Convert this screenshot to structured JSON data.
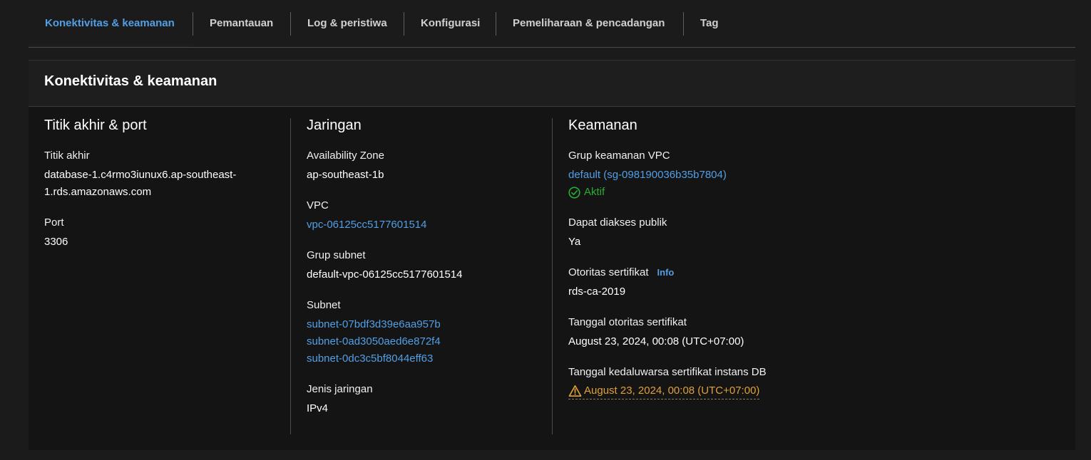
{
  "tabs": [
    {
      "label": "Konektivitas & keamanan",
      "active": true
    },
    {
      "label": "Pemantauan"
    },
    {
      "label": "Log & peristiwa"
    },
    {
      "label": "Konfigurasi"
    },
    {
      "label": "Pemeliharaan & pencadangan"
    },
    {
      "label": "Tag"
    }
  ],
  "panel": {
    "title": "Konektivitas & keamanan"
  },
  "endpoint_col": {
    "title": "Titik akhir & port",
    "endpoint_label": "Titik akhir",
    "endpoint_line1": "database-1.c4rmo3iunux6.ap-southeast-",
    "endpoint_line2": "1.rds.amazonaws.com",
    "port_label": "Port",
    "port_value": "3306"
  },
  "network_col": {
    "title": "Jaringan",
    "az_label": "Availability Zone",
    "az_value": "ap-southeast-1b",
    "vpc_label": "VPC",
    "vpc_value": "vpc-06125cc5177601514",
    "subnet_group_label": "Grup subnet",
    "subnet_group_value": "default-vpc-06125cc5177601514",
    "subnet_label": "Subnet",
    "subnets": [
      "subnet-07bdf3d39e6aa957b",
      "subnet-0ad3050aed6e872f4",
      "subnet-0dc3c5bf8044eff63"
    ],
    "network_type_label": "Jenis jaringan",
    "network_type_value": "IPv4"
  },
  "security_col": {
    "title": "Keamanan",
    "sg_label": "Grup keamanan VPC",
    "sg_value": "default (sg-098190036b35b7804)",
    "sg_status": "Aktif",
    "public_label": "Dapat diakses publik",
    "public_value": "Ya",
    "ca_label": "Otoritas sertifikat",
    "ca_info": "Info",
    "ca_value": "rds-ca-2019",
    "ca_date_label": "Tanggal otoritas sertifikat",
    "ca_date_value": "August 23, 2024, 00:08 (UTC+07:00)",
    "expiry_label": "Tanggal kedaluwarsa sertifikat instans DB",
    "expiry_value": "August 23, 2024, 00:08 (UTC+07:00)"
  },
  "colors": {
    "link": "#539fe5",
    "success": "#29ad32",
    "warning": "#e0a03a"
  }
}
